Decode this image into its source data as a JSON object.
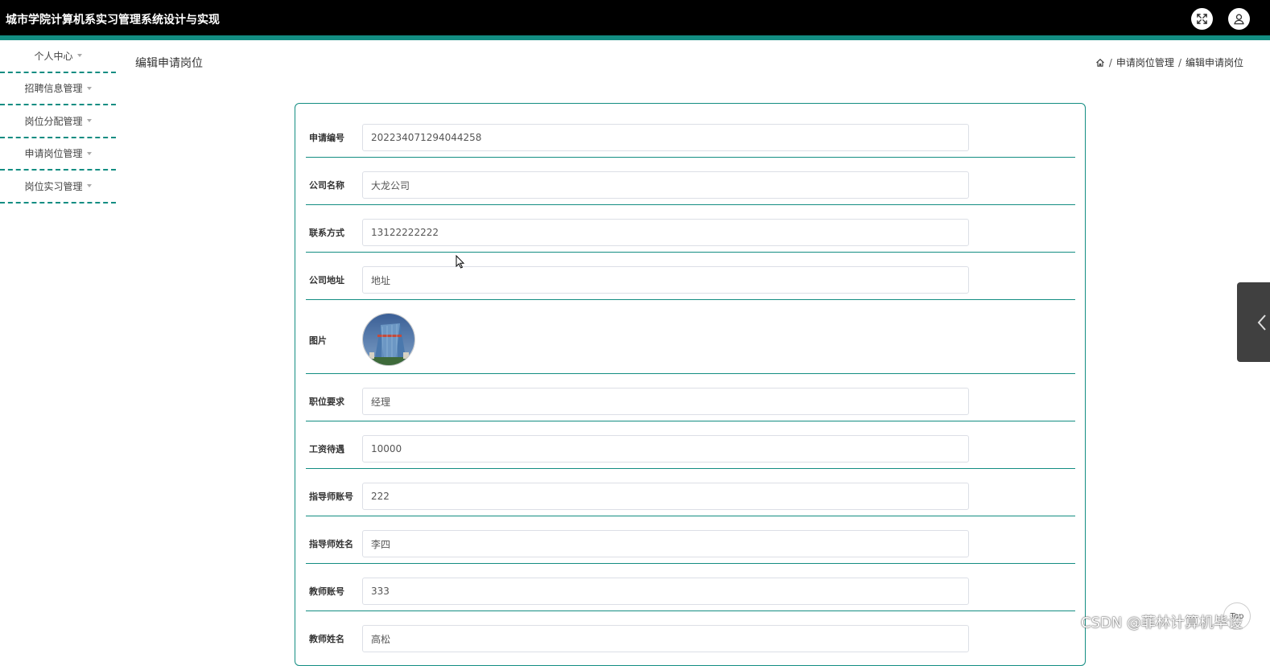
{
  "app": {
    "title": "城市学院计算机系实习管理系统设计与实现"
  },
  "header": {
    "fullscreen_icon": "fullscreen-icon",
    "user_icon": "user-icon"
  },
  "sidebar": {
    "items": [
      {
        "label": "个人中心"
      },
      {
        "label": "招聘信息管理"
      },
      {
        "label": "岗位分配管理"
      },
      {
        "label": "申请岗位管理"
      },
      {
        "label": "岗位实习管理"
      }
    ]
  },
  "page": {
    "title": "编辑申请岗位",
    "breadcrumb": [
      "申请岗位管理",
      "编辑申请岗位"
    ]
  },
  "form": {
    "fields": [
      {
        "label": "申请编号",
        "value": "202234071294044258"
      },
      {
        "label": "公司名称",
        "value": "大龙公司"
      },
      {
        "label": "联系方式",
        "value": "13122222222"
      },
      {
        "label": "公司地址",
        "value": "地址"
      },
      {
        "label": "图片"
      },
      {
        "label": "职位要求",
        "value": "经理"
      },
      {
        "label": "工资待遇",
        "value": "10000"
      },
      {
        "label": "指导师账号",
        "value": "222"
      },
      {
        "label": "指导师姓名",
        "value": "李四"
      },
      {
        "label": "教师账号",
        "value": "333"
      },
      {
        "label": "教师姓名",
        "value": "高松"
      }
    ]
  },
  "floating": {
    "to_top_label": "Top"
  },
  "watermark": "CSDN @菲林计算机毕设",
  "colors": {
    "accent": "#138d82",
    "header_bg": "#000000"
  }
}
